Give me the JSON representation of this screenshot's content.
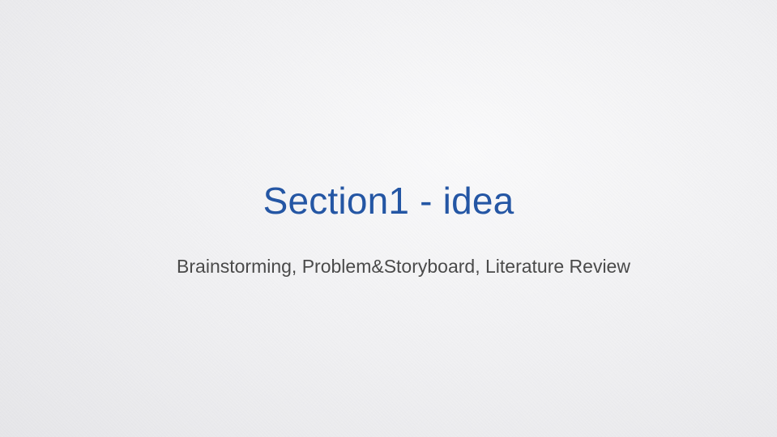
{
  "slide": {
    "title": "Section1 - idea",
    "subtitle": "Brainstorming, Problem&Storyboard, Literature Review"
  },
  "colors": {
    "title": "#2456a4",
    "subtitle": "#4a4a4a",
    "background": "#eeeef0"
  }
}
